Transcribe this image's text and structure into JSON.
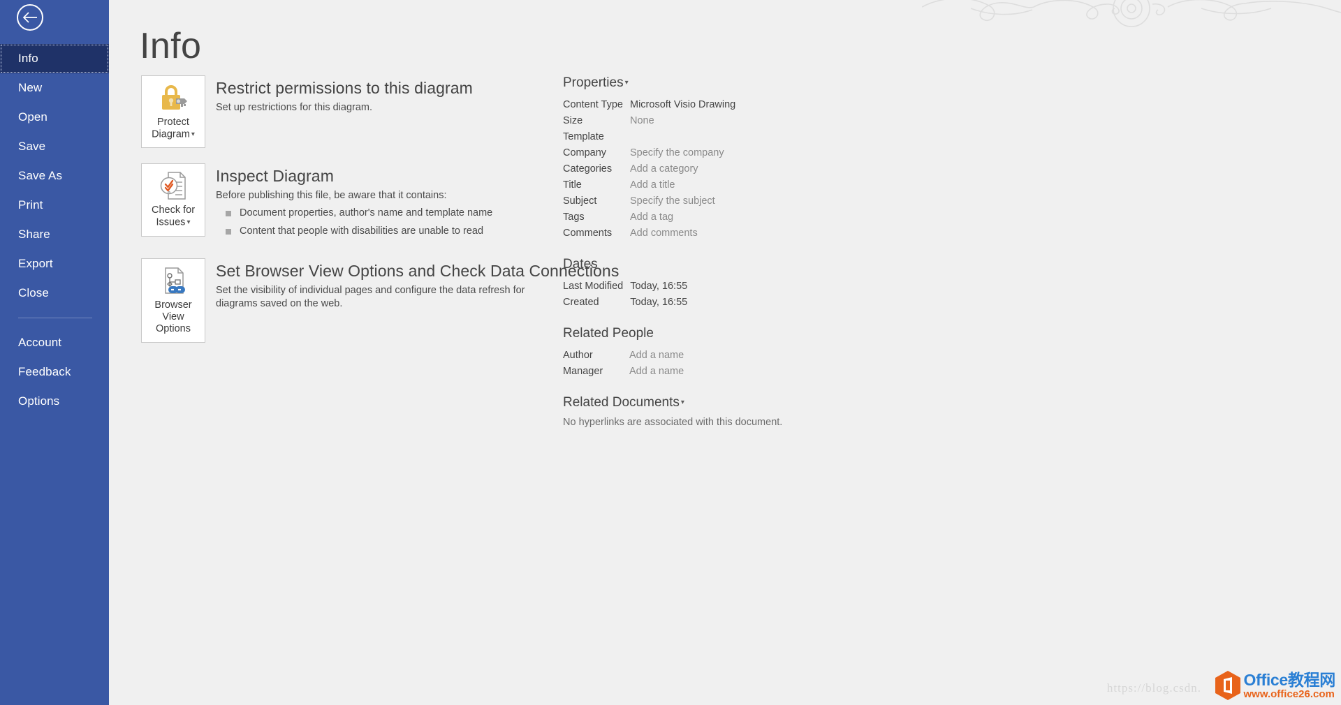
{
  "window": {
    "title": "Info",
    "back_icon": "back-arrow-icon"
  },
  "sidebar": {
    "items": [
      {
        "label": "Info",
        "selected": true
      },
      {
        "label": "New",
        "selected": false
      },
      {
        "label": "Open",
        "selected": false
      },
      {
        "label": "Save",
        "selected": false
      },
      {
        "label": "Save As",
        "selected": false
      },
      {
        "label": "Print",
        "selected": false
      },
      {
        "label": "Share",
        "selected": false
      },
      {
        "label": "Export",
        "selected": false
      },
      {
        "label": "Close",
        "selected": false
      }
    ],
    "bottom_items": [
      {
        "label": "Account"
      },
      {
        "label": "Feedback"
      },
      {
        "label": "Options"
      }
    ],
    "bg_color": "#3a58a4",
    "selected_color": "#1f3268"
  },
  "main": {
    "heading": "Info",
    "actions": [
      {
        "button_label_line1": "Protect",
        "button_label_line2": "Diagram",
        "has_caret": true,
        "icon": "lock-key-icon",
        "heading": "Restrict permissions to this diagram",
        "description": "Set up restrictions for this diagram.",
        "bullets": []
      },
      {
        "button_label_line1": "Check for",
        "button_label_line2": "Issues",
        "has_caret": true,
        "icon": "document-check-icon",
        "heading": "Inspect Diagram",
        "description": "Before publishing this file, be aware that it contains:",
        "bullets": [
          "Document properties, author's name and template name",
          "Content that people with disabilities are unable to read"
        ]
      },
      {
        "button_label_line1": "Browser View",
        "button_label_line2": "Options",
        "has_caret": false,
        "icon": "document-link-icon",
        "heading": "Set Browser View Options and Check Data Connections",
        "description": "Set the visibility of individual pages and configure the data refresh for diagrams saved on the web.",
        "bullets": []
      }
    ]
  },
  "properties": {
    "title": "Properties",
    "has_caret": true,
    "rows": [
      {
        "label": "Content Type",
        "value": "Microsoft Visio Drawing",
        "placeholder": false
      },
      {
        "label": "Size",
        "value": "None",
        "placeholder": true
      },
      {
        "label": "Template",
        "value": "",
        "placeholder": false
      },
      {
        "label": "Company",
        "value": "Specify the company",
        "placeholder": true
      },
      {
        "label": "Categories",
        "value": "Add a category",
        "placeholder": true
      },
      {
        "label": "Title",
        "value": "Add a title",
        "placeholder": true
      },
      {
        "label": "Subject",
        "value": "Specify the subject",
        "placeholder": true
      },
      {
        "label": "Tags",
        "value": "Add a tag",
        "placeholder": true
      },
      {
        "label": "Comments",
        "value": "Add comments",
        "placeholder": true
      }
    ]
  },
  "dates": {
    "title": "Dates",
    "rows": [
      {
        "label": "Last Modified",
        "value": "Today, 16:55"
      },
      {
        "label": "Created",
        "value": "Today, 16:55"
      }
    ]
  },
  "related_people": {
    "title": "Related People",
    "rows": [
      {
        "label": "Author",
        "value": "Add a name",
        "placeholder": true
      },
      {
        "label": "Manager",
        "value": "Add a name",
        "placeholder": true
      }
    ]
  },
  "related_documents": {
    "title": "Related Documents",
    "has_caret": true,
    "note": "No hyperlinks are associated with this document."
  },
  "watermarks": {
    "csdn": "https://blog.csdn.",
    "office_cn": "Office教程网",
    "office_url": "www.office26.com"
  },
  "colors": {
    "accent_blue": "#3a58a4",
    "selected_navy": "#1f3268",
    "page_bg": "#f0f0f0",
    "text_dark": "#444444",
    "text_placeholder": "#8a8a8a",
    "lock_gold": "#e8b84b",
    "check_orange": "#e05a24",
    "link_blue": "#3878c0"
  }
}
